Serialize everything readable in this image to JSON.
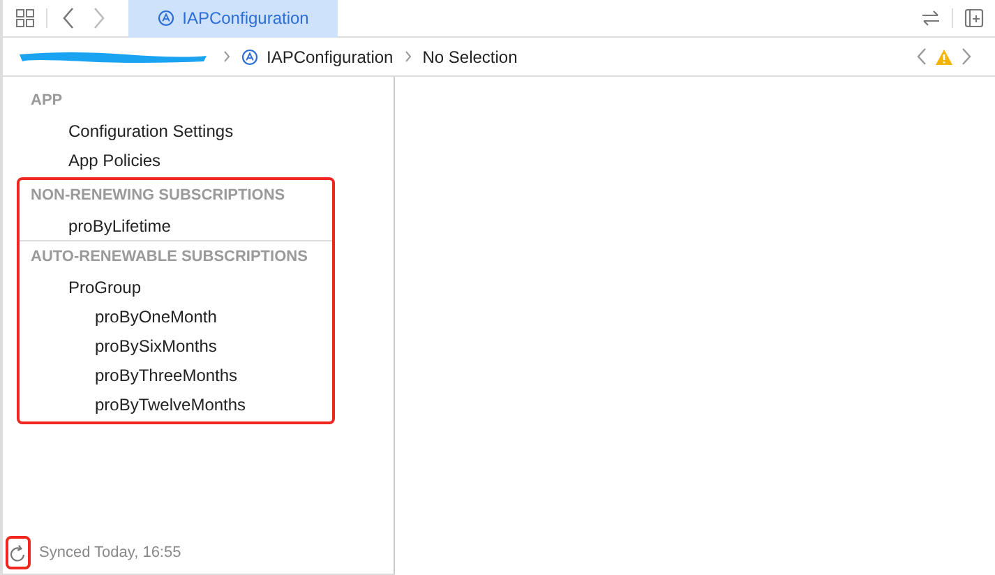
{
  "toolbar": {
    "tab": {
      "label": "IAPConfiguration",
      "selected": true
    }
  },
  "breadcrumb": {
    "items": [
      "IAPConfiguration",
      "No Selection"
    ],
    "warning": true
  },
  "sidebar": {
    "groups": [
      {
        "highlighted": false,
        "sections": [
          {
            "title": "APP",
            "items": [
              {
                "label": "Configuration Settings"
              },
              {
                "label": "App Policies"
              }
            ]
          }
        ]
      },
      {
        "highlighted": true,
        "sections": [
          {
            "title": "NON-RENEWING SUBSCRIPTIONS",
            "items": [
              {
                "label": "proByLifetime"
              }
            ]
          },
          {
            "title": "AUTO-RENEWABLE SUBSCRIPTIONS",
            "items": [
              {
                "label": "ProGroup",
                "children": [
                  {
                    "label": "proByOneMonth"
                  },
                  {
                    "label": "proBySixMonths"
                  },
                  {
                    "label": "proByThreeMonths"
                  },
                  {
                    "label": "proByTwelveMonths"
                  }
                ]
              }
            ]
          }
        ]
      }
    ]
  },
  "sync": {
    "text": "Synced Today, 16:55",
    "highlighted": true
  }
}
